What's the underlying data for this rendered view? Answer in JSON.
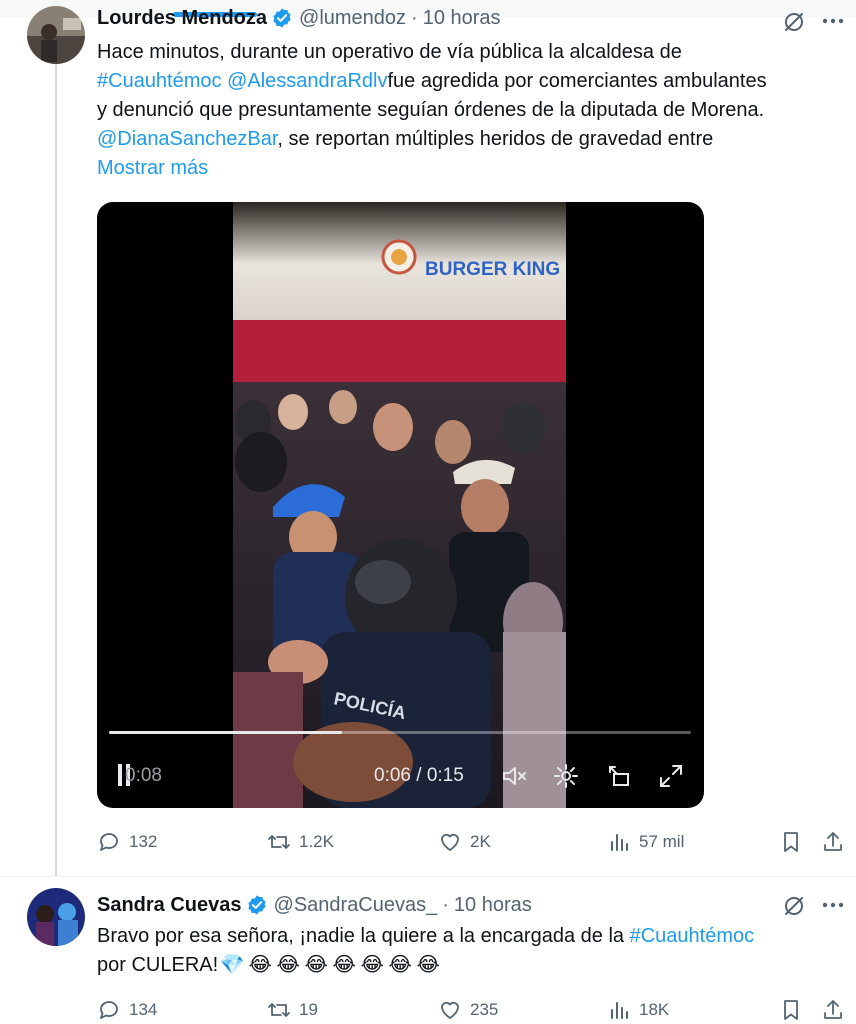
{
  "tweets": [
    {
      "display_name": "Lourdes Mendoza",
      "handle": "@lumendoz",
      "separator": "·",
      "time": "10 horas",
      "lines": [
        [
          {
            "t": "Hace minutos, durante un operativo de vía pública la alcaldesa de",
            "link": false
          }
        ],
        [
          {
            "t": "#Cuauhtémoc",
            "link": true
          },
          {
            "t": " ",
            "link": false
          },
          {
            "t": "@AlessandraRdlv",
            "link": true
          },
          {
            "t": "fue agredida por comerciantes ambulantes",
            "link": false
          }
        ],
        [
          {
            "t": "y denunció que presuntamente seguían órdenes de la diputada de Morena.",
            "link": false
          }
        ],
        [
          {
            "t": "@DianaSanchezBar",
            "link": true
          },
          {
            "t": ", se reportan múltiples heridos de gravedad entre",
            "link": false
          }
        ]
      ],
      "show_more": "Mostrar más",
      "video": {
        "elapsed": "0:06",
        "time_display": "0:06 / 0:15",
        "leftover_label": "0:08",
        "progress": 0.4,
        "sign_text": "BURGER KING",
        "vest_text": "POLICÍA"
      },
      "stats": {
        "replies": "132",
        "retweets": "1.2K",
        "likes": "2K",
        "views": "57 mil"
      }
    },
    {
      "display_name": "Sandra Cuevas",
      "handle": "@SandraCuevas_",
      "separator": "·",
      "time": "10 horas",
      "lines": [
        [
          {
            "t": "Bravo por esa señora, ¡nadie la quiere a la encargada de la ",
            "link": false
          },
          {
            "t": "#Cuauhtémoc",
            "link": true
          }
        ],
        [
          {
            "t": "por CULERA!",
            "link": false
          }
        ]
      ],
      "emojis": [
        "💎",
        "😂",
        "😂",
        "😂",
        "😂",
        "😂",
        "😂",
        "😂"
      ],
      "stats": {
        "replies": "134",
        "retweets": "19",
        "likes": "235",
        "views": "18K"
      }
    }
  ],
  "icons": {
    "verified": "verified-badge-icon",
    "grok": "grok-icon",
    "more": "more-options-icon",
    "reply": "reply-icon",
    "retweet": "retweet-icon",
    "like": "heart-icon",
    "views": "views-chart-icon",
    "bookmark": "bookmark-icon",
    "share": "share-icon"
  },
  "colors": {
    "accent": "#1d9bf0",
    "text": "#0f1419",
    "muted": "#536471",
    "thread_line": "#cfd9de"
  }
}
